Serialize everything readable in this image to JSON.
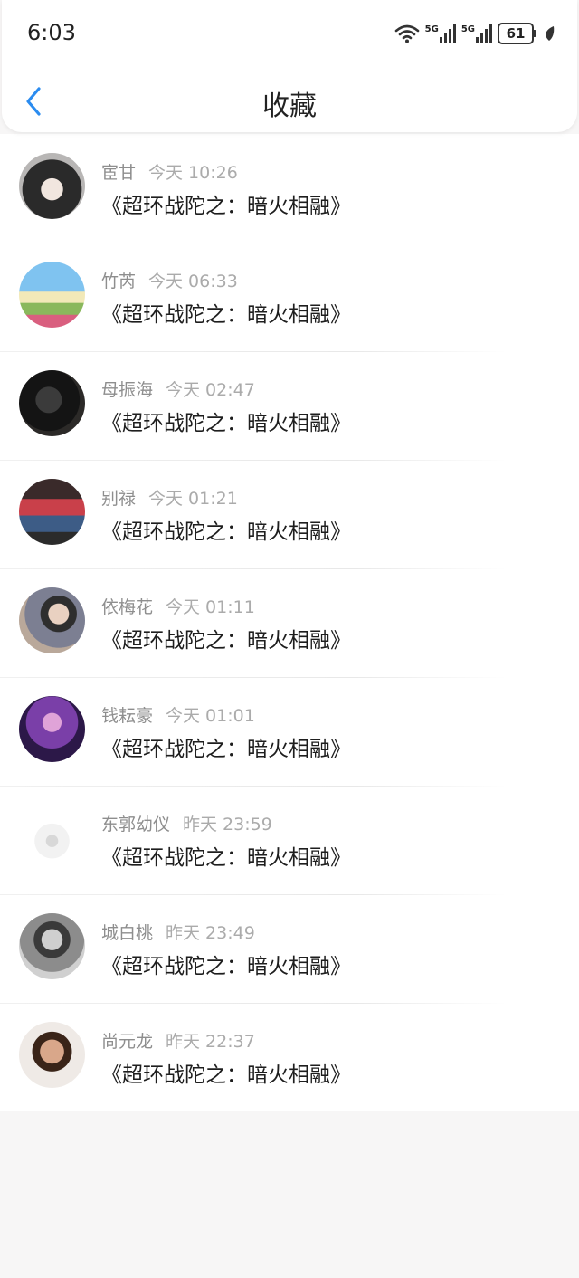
{
  "status_bar": {
    "time": "6:03",
    "signal1_label": "5G",
    "signal2_label": "5G",
    "battery": "61"
  },
  "header": {
    "title": "收藏"
  },
  "favorites": [
    {
      "name": "宦甘",
      "time": "今天 10:26",
      "title": "《超环战陀之：暗火相融》",
      "avatar": "avatar-girl-dark-hair"
    },
    {
      "name": "竹芮",
      "time": "今天 06:33",
      "title": "《超环战陀之：暗火相融》",
      "avatar": "avatar-flowers-sign"
    },
    {
      "name": "母振海",
      "time": "今天 02:47",
      "title": "《超环战陀之：暗火相融》",
      "avatar": "avatar-man-dark"
    },
    {
      "name": "别禄",
      "time": "今天 01:21",
      "title": "《超环战陀之：暗火相融》",
      "avatar": "avatar-sneakers"
    },
    {
      "name": "依梅花",
      "time": "今天 01:11",
      "title": "《超环战陀之：暗火相融》",
      "avatar": "avatar-young-man"
    },
    {
      "name": "钱耘豪",
      "time": "今天 01:01",
      "title": "《超环战陀之：暗火相融》",
      "avatar": "avatar-purple-warrior"
    },
    {
      "name": "东郭幼仪",
      "time": "昨天 23:59",
      "title": "《超环战陀之：暗火相融》",
      "avatar": "avatar-white-sketch"
    },
    {
      "name": "城白桃",
      "time": "昨天 23:49",
      "title": "《超环战陀之：暗火相融》",
      "avatar": "avatar-man-bw"
    },
    {
      "name": "尚元龙",
      "time": "昨天 22:37",
      "title": "《超环战陀之：暗火相融》",
      "avatar": "avatar-boy-selfie"
    }
  ],
  "colors": {
    "accent": "#2b8cf0",
    "page_background": "#f7f6f6",
    "meta_text": "#9a9a9a"
  }
}
